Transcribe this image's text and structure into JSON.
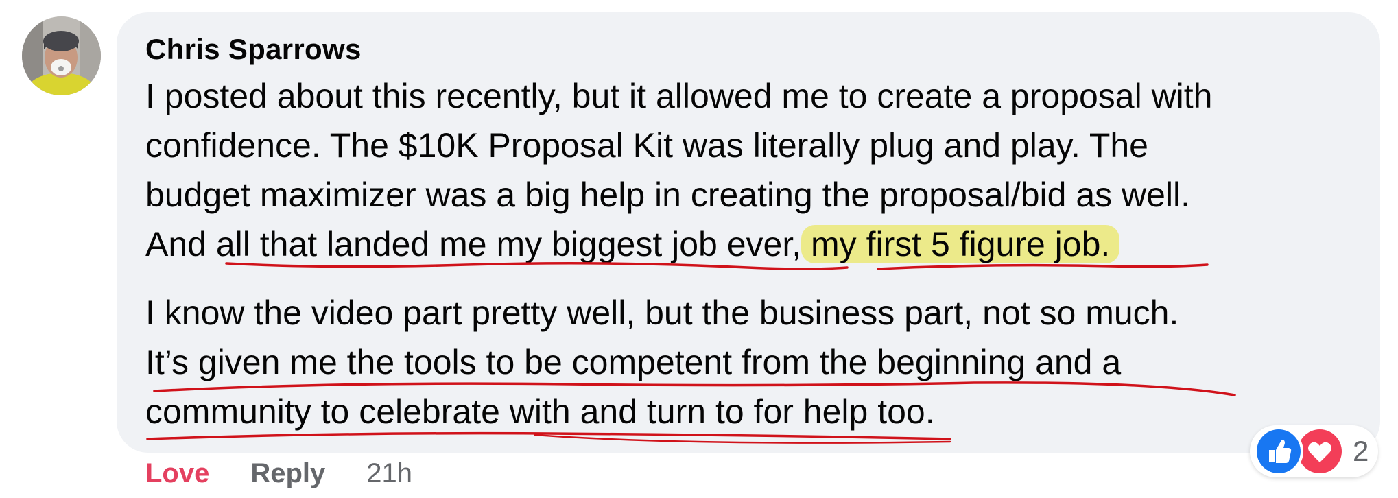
{
  "comment": {
    "author": "Chris Sparrows",
    "paragraph1": {
      "line1": "I posted about this recently, but it allowed me to create a proposal with",
      "line2": "confidence. The $10K Proposal Kit was literally plug and play. The",
      "line3": "budget maximizer was a big help in creating the proposal/bid as well.",
      "line4_start": "And all that landed me my biggest job ever,",
      "line4_highlight": " my first 5 figure job."
    },
    "paragraph2": {
      "line1": "I know the video part pretty well, but the business part, not so much.",
      "line2": "It’s given me the tools to be competent from the beginning and a",
      "line3": "community to celebrate with and turn to for help too."
    }
  },
  "actions": {
    "love_label": "Love",
    "reply_label": "Reply",
    "timestamp": "21h"
  },
  "reactions": {
    "icons": [
      "like-icon",
      "love-icon"
    ],
    "count": "2",
    "like_color": "#1877f2",
    "love_color": "#f33e58"
  },
  "annotations": {
    "highlight_color": "#ecea8a",
    "underline_color": "#d0121a"
  }
}
